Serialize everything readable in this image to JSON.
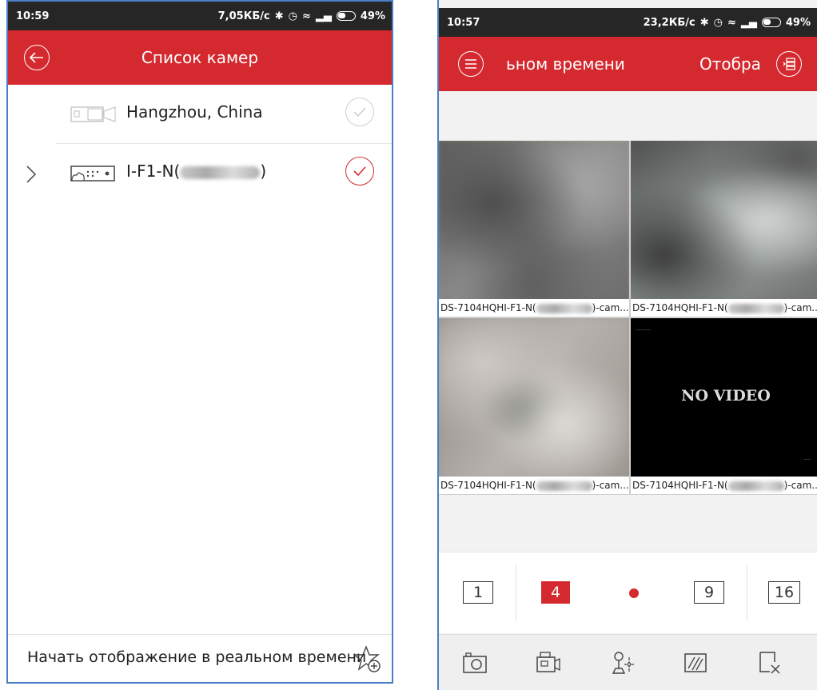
{
  "left": {
    "status": {
      "time": "10:59",
      "speed": "7,05КБ/с",
      "battery": "49%"
    },
    "appbar": {
      "title": "Список камер",
      "back_icon": "back-arrow-icon"
    },
    "rows": [
      {
        "label": "Hangzhou, China",
        "checked": false,
        "icon": "camera-icon"
      },
      {
        "label_prefix": "I-F1-N(",
        "label_suffix": ")",
        "checked": true,
        "icon": "dvr-icon"
      }
    ],
    "footer": {
      "label": "Начать отображение в реальном времени",
      "icon": "star-add-icon"
    }
  },
  "right": {
    "status": {
      "time": "10:57",
      "speed": "23,2КБ/с",
      "battery": "49%"
    },
    "appbar": {
      "title": "ьном времени",
      "action": "Отобра"
    },
    "tiles": [
      {
        "prefix": "DS-7104HQHI-F1-N(",
        "suffix": ")-cam...",
        "selected": true
      },
      {
        "prefix": "DS-7104HQHI-F1-N(",
        "suffix": ")-cam..."
      },
      {
        "prefix": "DS-7104HQHI-F1-N(",
        "suffix": ")-cam..."
      },
      {
        "prefix": "DS-7104HQHI-F1-N(",
        "suffix": ")-cam...",
        "overlay": "NO VIDEO"
      }
    ],
    "splits": [
      "1",
      "4",
      "9",
      "16"
    ],
    "active_split": "4",
    "toolbar": [
      "camera-snapshot-icon",
      "video-record-icon",
      "ptz-icon",
      "image-quality-icon",
      "close-window-icon"
    ],
    "colors": {
      "accent": "#d42a2f",
      "selection": "#e5c24a"
    }
  }
}
